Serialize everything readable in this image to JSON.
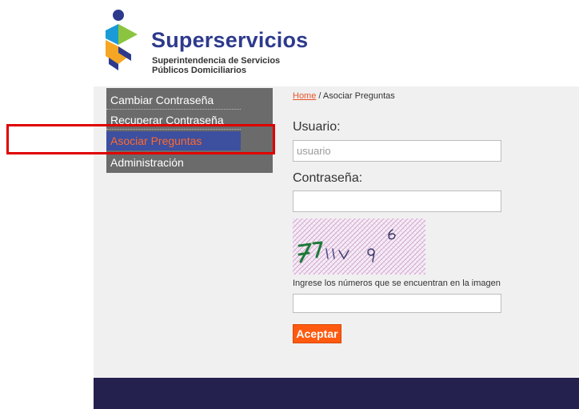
{
  "header": {
    "brand_title": "Superservicios",
    "brand_subtitle_line1": "Superintendencia de Servicios",
    "brand_subtitle_line2": "Públicos Domiciliarios"
  },
  "menu": {
    "items": [
      {
        "label": "Cambiar Contraseña"
      },
      {
        "label": "Recuperar Contraseña"
      },
      {
        "label": "Asociar Preguntas",
        "active": true
      },
      {
        "label": "Administración"
      }
    ]
  },
  "breadcrumb": {
    "home_link": "Home",
    "separator": " / ",
    "current": "Asociar Preguntas"
  },
  "form": {
    "usuario_label": "Usuario:",
    "usuario_placeholder": "usuario",
    "usuario_value": "",
    "password_label": "Contraseña:",
    "password_value": "",
    "captcha_text": "77119 6",
    "captcha_hint": "Ingrese los números que se encuentran en la imagen",
    "captcha_value": "",
    "submit_label": "Aceptar"
  },
  "colors": {
    "brand_blue": "#2d3a8c",
    "menu_bg": "#6b6b6b",
    "menu_active_bg": "#3d4f9f",
    "accent_orange": "#ff5a0f",
    "footer_bg": "#24214f",
    "highlight_red": "#e00000"
  }
}
